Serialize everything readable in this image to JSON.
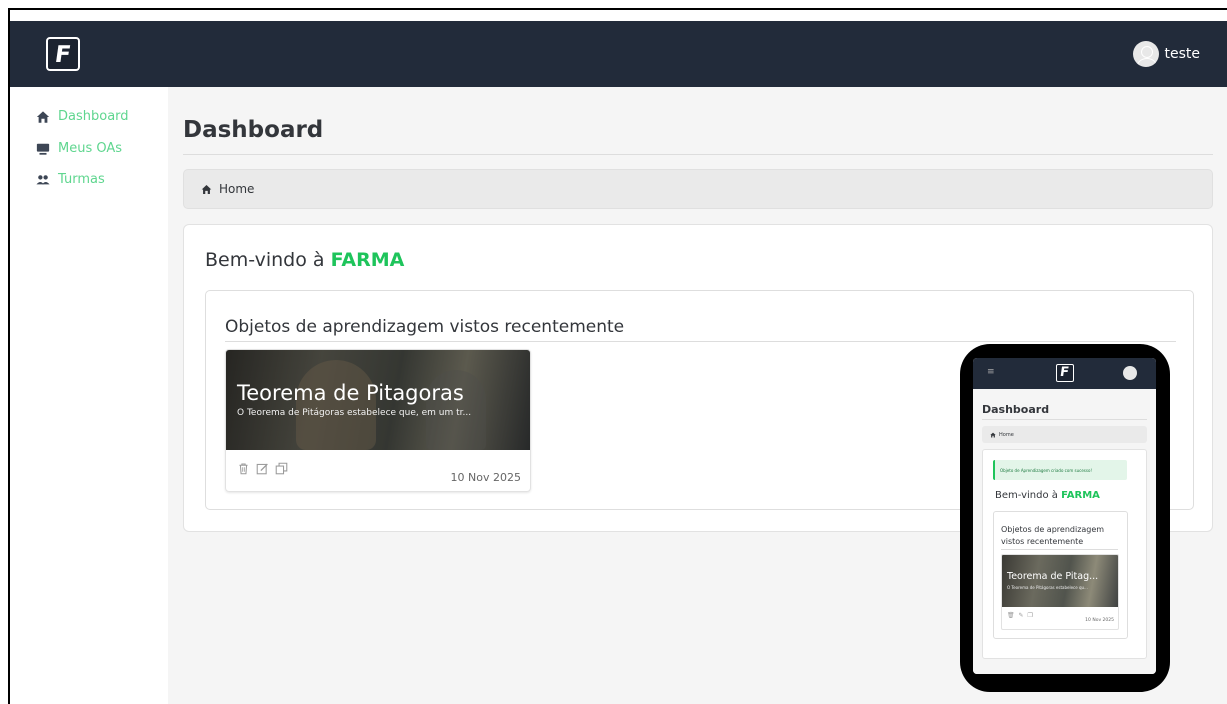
{
  "header": {
    "logo_letter": "F",
    "user_name": "teste"
  },
  "sidebar": {
    "items": [
      {
        "label": "Dashboard",
        "icon": "home-icon"
      },
      {
        "label": "Meus OAs",
        "icon": "monitor-icon"
      },
      {
        "label": "Turmas",
        "icon": "users-icon"
      }
    ],
    "accent_color": "#5fd68f"
  },
  "main": {
    "page_title": "Dashboard",
    "breadcrumb": "Home",
    "welcome_prefix": "Bem-vindo à ",
    "brand_name": "FARMA",
    "brand_color": "#1ec45b",
    "recent_title": "Objetos de aprendizagem vistos recentemente",
    "oa_card": {
      "title": "Teorema de Pitagoras",
      "description": "O Teorema de Pitágoras estabelece que, em um tr...",
      "date": "10 Nov 2025"
    }
  },
  "mobile": {
    "logo_letter": "F",
    "menu_icon": "≡",
    "page_title": "Dashboard",
    "breadcrumb": "Home",
    "alert": "Objeto de Aprendizagem criado com sucesso!",
    "welcome_prefix": "Bem-vindo à ",
    "brand_name": "FARMA",
    "recent_title": "Objetos de aprendizagem vistos recentemente",
    "oa_title": "Teorema de Pitag...",
    "oa_description": "O Teorema de Pitágoras estabelece qu...",
    "oa_date": "10 Nov 2025"
  }
}
